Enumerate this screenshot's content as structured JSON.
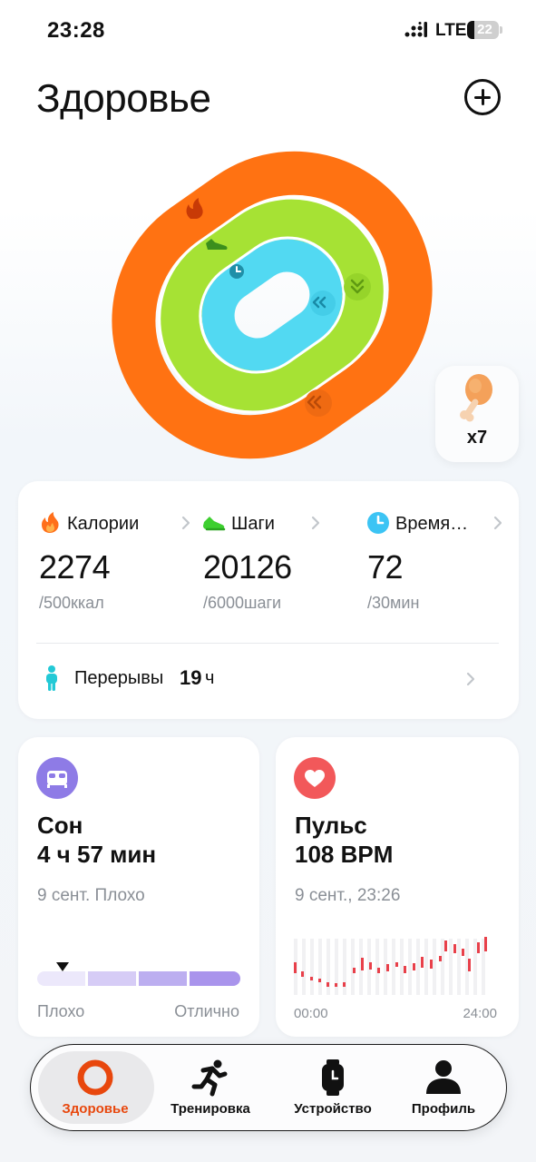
{
  "status_bar": {
    "time": "23:28",
    "network": "LTE",
    "battery": "22"
  },
  "header": {
    "title": "Здоровье"
  },
  "food": {
    "count": "x7"
  },
  "colors": {
    "calories": "#ff7212",
    "steps": "#a6e234",
    "time": "#52d9f2",
    "sleep": "#8e7be6",
    "pulse": "#f2585a",
    "accent": "#e8470d"
  },
  "activity": {
    "metrics": [
      {
        "label": "Калории",
        "value": "2274",
        "goal": "/500ккал",
        "icon": "flame-icon"
      },
      {
        "label": "Шаги",
        "value": "20126",
        "goal": "/6000шаги",
        "icon": "sneaker-icon"
      },
      {
        "label": "Время…",
        "value": "72",
        "goal": "/30мин",
        "icon": "clock-icon"
      }
    ],
    "breaks": {
      "label": "Перерывы",
      "value": "19",
      "unit": "ч"
    }
  },
  "sleep": {
    "title": "Сон",
    "value": "4 ч 57 мин",
    "date_text": "9 сент. Плохо",
    "scale_low": "Плохо",
    "scale_high": "Отлично"
  },
  "pulse": {
    "title": "Пульс",
    "value": "108 BPM",
    "date_text": "9 сент., 23:26",
    "axis_start": "00:00",
    "axis_end": "24:00"
  },
  "tabs": [
    {
      "label": "Здоровье",
      "icon": "health-ring-icon",
      "active": true
    },
    {
      "label": "Тренировка",
      "icon": "runner-icon",
      "active": false
    },
    {
      "label": "Устройство",
      "icon": "watch-icon",
      "active": false
    },
    {
      "label": "Профиль",
      "icon": "person-icon",
      "active": false
    }
  ]
}
